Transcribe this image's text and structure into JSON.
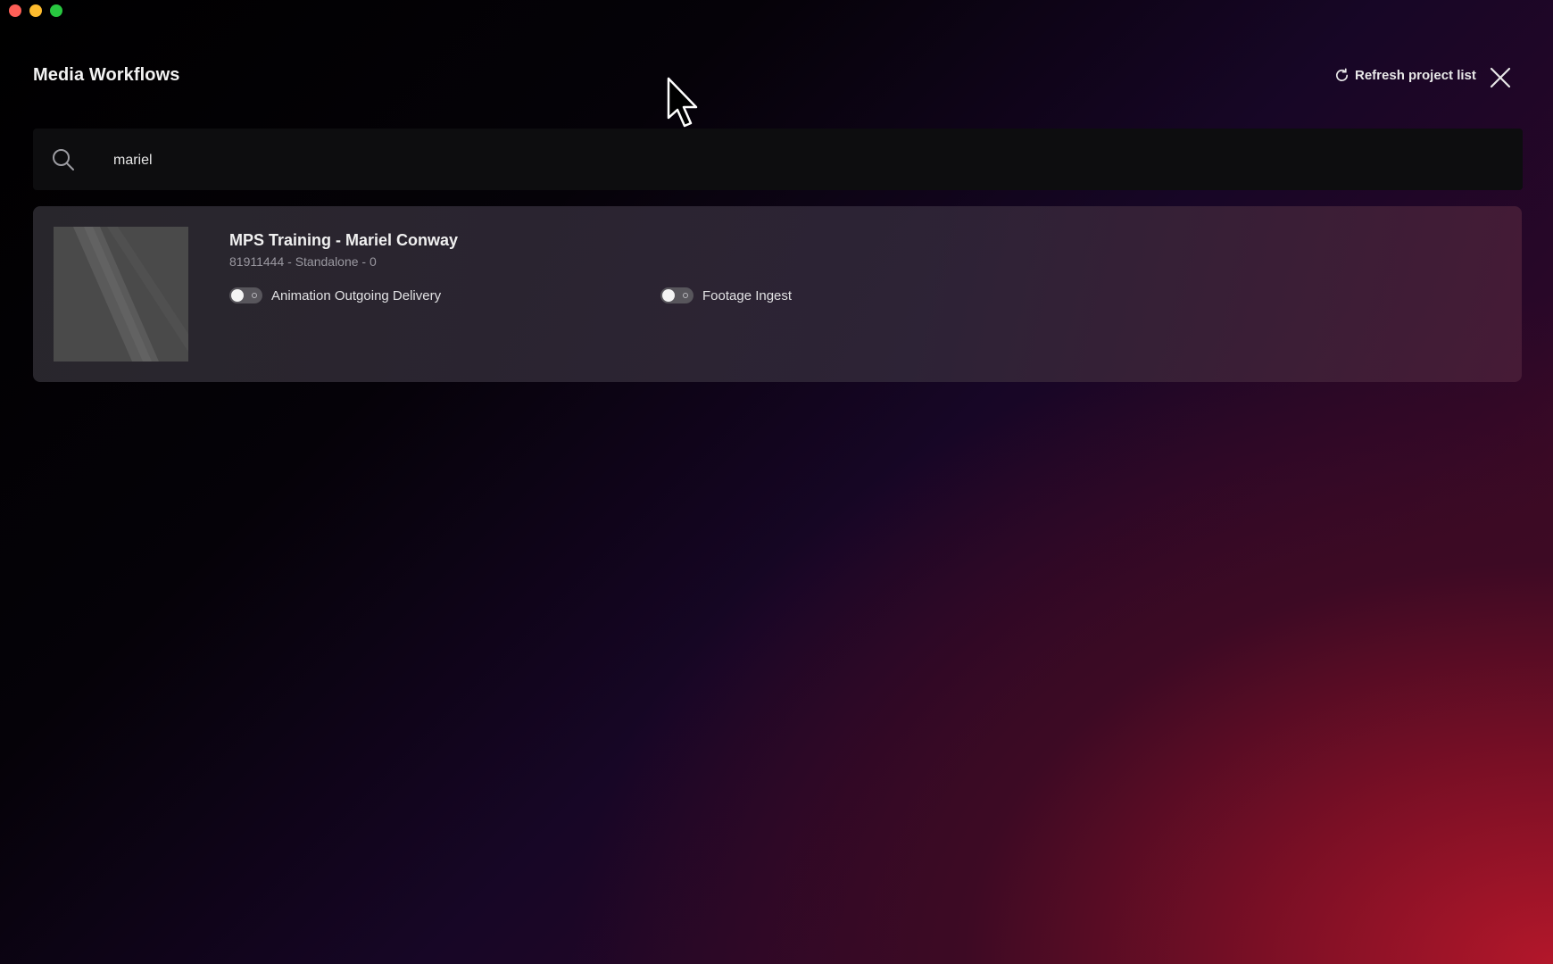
{
  "window": {
    "controls": [
      "close",
      "minimize",
      "maximize"
    ]
  },
  "header": {
    "title": "Media Workflows",
    "refresh_label": "Refresh project list",
    "refresh_icon": "refresh-icon",
    "close_icon": "close-icon"
  },
  "search": {
    "value": "mariel",
    "icon": "search-icon"
  },
  "projects": [
    {
      "title": "MPS Training - Mariel Conway",
      "subtitle": "81911444 - Standalone - 0",
      "workflows": [
        {
          "label": "Animation Outgoing Delivery",
          "enabled": false
        },
        {
          "label": "Footage Ingest",
          "enabled": false
        }
      ]
    }
  ],
  "colors": {
    "accent_red": "#b3172a",
    "card_bg": "#2a282e",
    "search_bg": "#0d0d0f"
  }
}
